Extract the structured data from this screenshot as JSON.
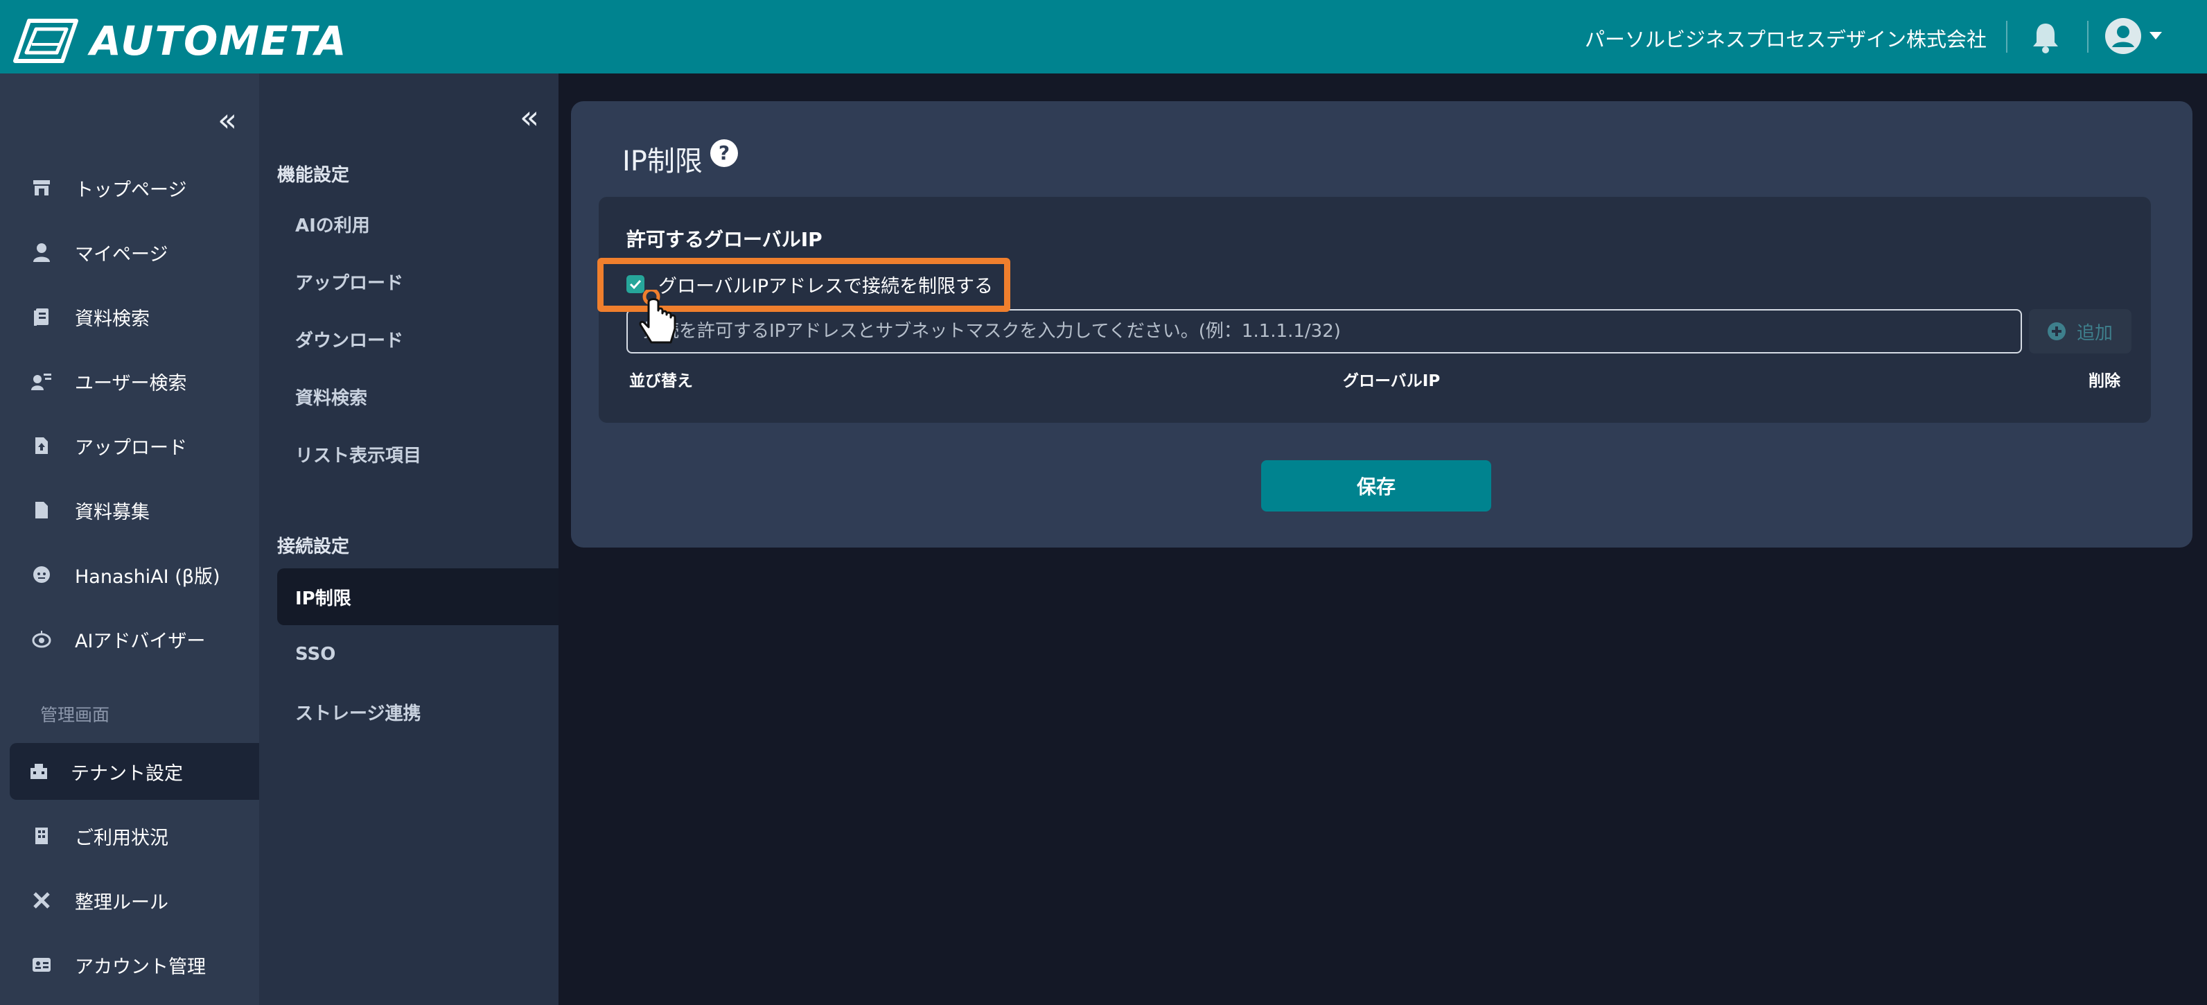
{
  "header": {
    "logo_text": "AUTOMETA",
    "company": "パーソルビジネスプロセスデザイン株式会社",
    "bell_icon": "bell-icon",
    "avatar_icon": "user-avatar-icon"
  },
  "sidebar": {
    "collapse_glyph": "«",
    "items": [
      {
        "label": "トップページ",
        "icon": "store-icon"
      },
      {
        "label": "マイページ",
        "icon": "person-icon"
      },
      {
        "label": "資料検索",
        "icon": "document-search-icon"
      },
      {
        "label": "ユーザー検索",
        "icon": "user-search-icon"
      },
      {
        "label": "アップロード",
        "icon": "file-upload-icon"
      },
      {
        "label": "資料募集",
        "icon": "file-icon"
      },
      {
        "label": "HanashiAI (β版)",
        "icon": "chat-bot-icon"
      },
      {
        "label": "AIアドバイザー",
        "icon": "robot-icon"
      }
    ],
    "admin_section": "管理画面",
    "admin_items": [
      {
        "label": "テナント設定",
        "icon": "building-settings-icon",
        "active": true
      },
      {
        "label": "ご利用状況",
        "icon": "building-icon"
      },
      {
        "label": "整理ルール",
        "icon": "tools-icon"
      },
      {
        "label": "アカウント管理",
        "icon": "id-card-icon"
      }
    ]
  },
  "subnav": {
    "collapse_glyph": "«",
    "section1": "機能設定",
    "items1": [
      "AIの利用",
      "アップロード",
      "ダウンロード",
      "資料検索",
      "リスト表示項目"
    ],
    "section2": "接続設定",
    "items2": [
      "IP制限",
      "SSO",
      "ストレージ連携"
    ],
    "active": "IP制限"
  },
  "main": {
    "title": "IP制限",
    "help_icon": "help-circle-icon",
    "card_title": "許可するグローバルIP",
    "checkbox_label": "グローバルIPアドレスで接続を制限する",
    "checkbox_checked": true,
    "input_placeholder": "接続を許可するIPアドレスとサブネットマスクを入力してください。(例：1.1.1.1/32)",
    "add_label": "追加",
    "columns": [
      "並び替え",
      "グローバルIP",
      "削除"
    ],
    "save_label": "保存"
  },
  "colors": {
    "header": "#00838f",
    "accent": "#00838f",
    "highlight": "#f07f2d",
    "checkbox": "#26a69a"
  }
}
